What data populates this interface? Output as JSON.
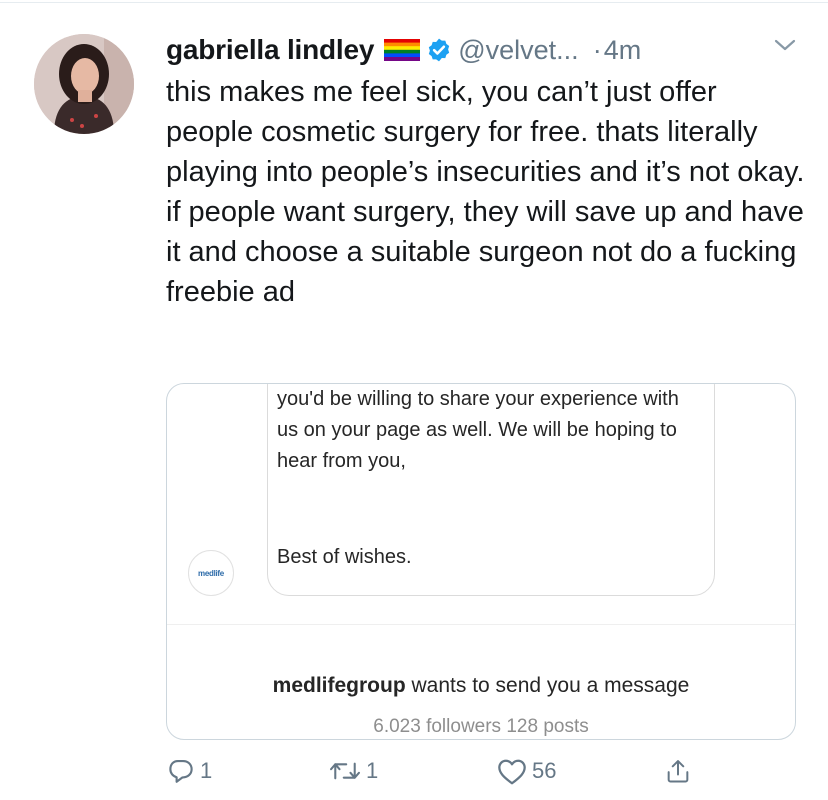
{
  "tweet": {
    "author_name": "gabriella lindley",
    "handle": "@velvet...",
    "separator": "·",
    "time": "4m",
    "text": "this makes me feel sick, you can’t just offer people cosmetic surgery for free. thats literally playing into people’s insecurities and it’s not okay. if people want surgery, they will save up and have it and choose a suitable surgeon not do a fucking freebie ad",
    "icons": {
      "flag": "rainbow-flag-icon",
      "verified": "verified-badge-icon",
      "menu": "chevron-down-icon"
    },
    "colors": {
      "verified": "#1da1f2",
      "secondary_text": "#657786"
    }
  },
  "embedded_card": {
    "message": "you'd be willing to share your experience with us on your page as well. We will be hoping to hear from you,",
    "signoff": "Best of wishes.",
    "logo_text": "medlife",
    "request_user": "medlifegroup",
    "request_text": " wants to send you a message",
    "stats": "6.023 followers 128 posts"
  },
  "actions": {
    "reply_count": "1",
    "retweet_count": "1",
    "like_count": "56",
    "icons": [
      "reply-icon",
      "retweet-icon",
      "like-icon",
      "share-icon"
    ]
  }
}
